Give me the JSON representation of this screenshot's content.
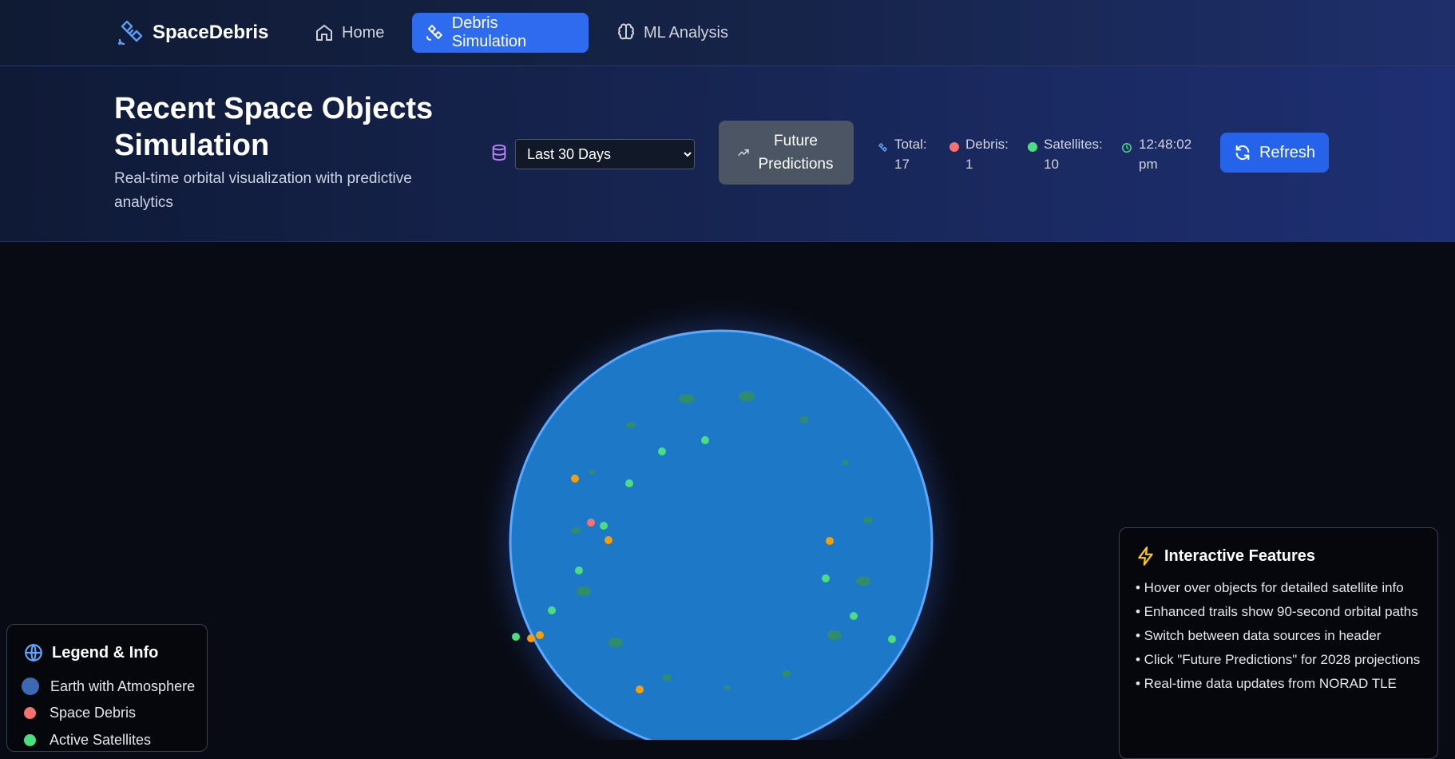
{
  "app": {
    "name": "SpaceDebris"
  },
  "nav": {
    "items": [
      {
        "label": "Home",
        "icon": "home-icon"
      },
      {
        "label": "Debris Simulation",
        "icon": "satellite-icon",
        "active": true
      },
      {
        "label": "ML Analysis",
        "icon": "brain-icon"
      }
    ]
  },
  "header": {
    "title": "Recent Space Objects Simulation",
    "subtitle": "Real-time orbital visualization with predictive analytics",
    "data_source": {
      "icon": "database-icon",
      "selected": "Last 30 Days"
    },
    "future_button": {
      "label": "Future Predictions",
      "icon": "trending-up-icon"
    },
    "stats": {
      "total_label": "Total:",
      "total_value": "17",
      "debris_label": "Debris:",
      "debris_value": "1",
      "satellites_label": "Satellites:",
      "satellites_value": "10",
      "time": "12:48:02 pm"
    },
    "refresh_label": "Refresh"
  },
  "legend": {
    "title": "Legend & Info",
    "items": [
      {
        "label": "Earth with Atmosphere"
      },
      {
        "label": "Space Debris"
      },
      {
        "label": "Active Satellites"
      }
    ]
  },
  "features": {
    "title": "Interactive Features",
    "items": [
      "• Hover over objects for detailed satellite info",
      "• Enhanced trails show 90-second orbital paths",
      "• Switch between data sources in header",
      "• Click \"Future Predictions\" for 2028 projections",
      "• Real-time data updates from NORAD TLE"
    ]
  },
  "colors": {
    "accent": "#2f6bee",
    "debris": "#f87171",
    "satellite": "#4ade80",
    "unknown": "#f59e0b",
    "earth": "#1e78c8"
  }
}
